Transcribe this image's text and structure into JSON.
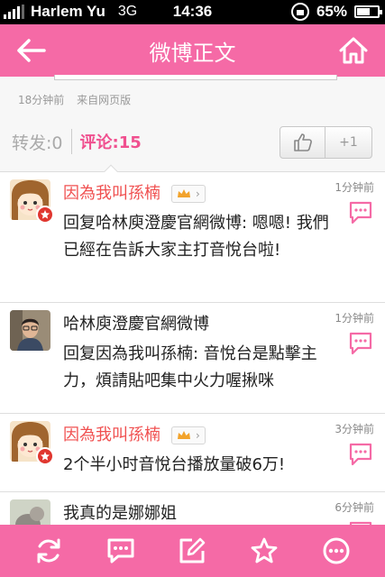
{
  "status_bar": {
    "carrier": "Harlem Yu",
    "network": "3G",
    "time": "14:36",
    "battery": "65%"
  },
  "nav": {
    "title": "微博正文",
    "back_icon": "back-arrow-icon",
    "home_icon": "home-icon"
  },
  "post": {
    "time_ago": "18分钟前",
    "source": "来自网页版",
    "repost_label": "转发:0",
    "comment_prefix": "评论:",
    "comment_count": "15",
    "plus_one": "+1"
  },
  "comments": [
    {
      "name": "因為我叫孫楠",
      "name_color": "#f05050",
      "vip": true,
      "time": "1分钟前",
      "text": "回复哈林庾澄慶官網微博: 嗯嗯! 我們已經在告訴大家主打音悅台啦!"
    },
    {
      "name": "哈林庾澄慶官網微博",
      "name_color": "#222222",
      "vip": false,
      "time": "1分钟前",
      "text": "回复因為我叫孫楠: 音悅台是點擊主力，煩請貼吧集中火力喔揪咪"
    },
    {
      "name": "因為我叫孫楠",
      "name_color": "#f05050",
      "vip": true,
      "time": "3分钟前",
      "text": "2个半小时音悅台播放量破6万!"
    },
    {
      "name": "我真的是娜娜姐",
      "name_color": "#222222",
      "vip": false,
      "time": "6分钟前",
      "text": ""
    }
  ],
  "toolbar": {
    "icons": [
      "refresh-icon",
      "comment-icon",
      "edit-icon",
      "star-icon",
      "more-icon"
    ]
  },
  "colors": {
    "accent": "#f56aa6",
    "highlight": "#f0508f"
  }
}
